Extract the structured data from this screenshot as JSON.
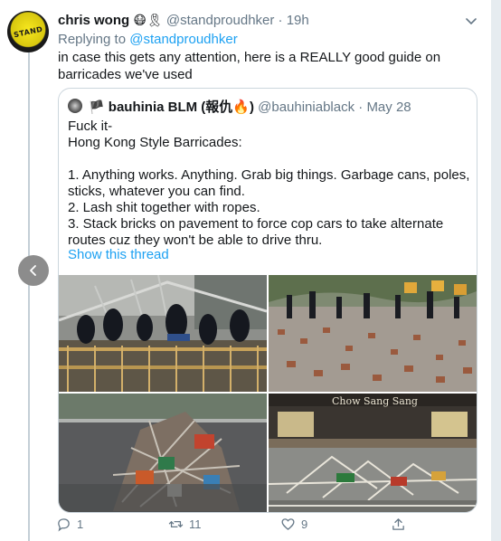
{
  "tweet": {
    "display_name": "chris wong",
    "name_emojis": "😷🎗",
    "handle": "@standproudhker",
    "separator": "·",
    "time": "19h",
    "avatar_text": "STAND",
    "replying_prefix": "Replying to",
    "replying_to": "@standproudhker",
    "text": "in case this gets any attention, here is a REALLY good guide on barricades we've used"
  },
  "quote": {
    "flag": "🏴",
    "display_name": "bauhinia BLM (報仇🔥)",
    "handle": "@bauhiniablack",
    "separator": "·",
    "date": "May 28",
    "lines": [
      "Fuck it-",
      "Hong Kong Style Barricades:",
      "",
      "1. Anything works. Anything. Grab big things. Garbage cans, poles, sticks, whatever you can find.",
      "2. Lash shit together with ropes.",
      "3. Stack bricks on pavement to force cop cars to take alternate routes cuz they won't be able to drive thru."
    ],
    "show_thread": "Show this thread",
    "photo_sign_text": "Chow Sang Sang"
  },
  "actions": {
    "reply_count": "1",
    "retweet_count": "11",
    "like_count": "9"
  },
  "colors": {
    "link": "#1da1f2",
    "muted": "#657786",
    "background": "#e6ecf0"
  }
}
